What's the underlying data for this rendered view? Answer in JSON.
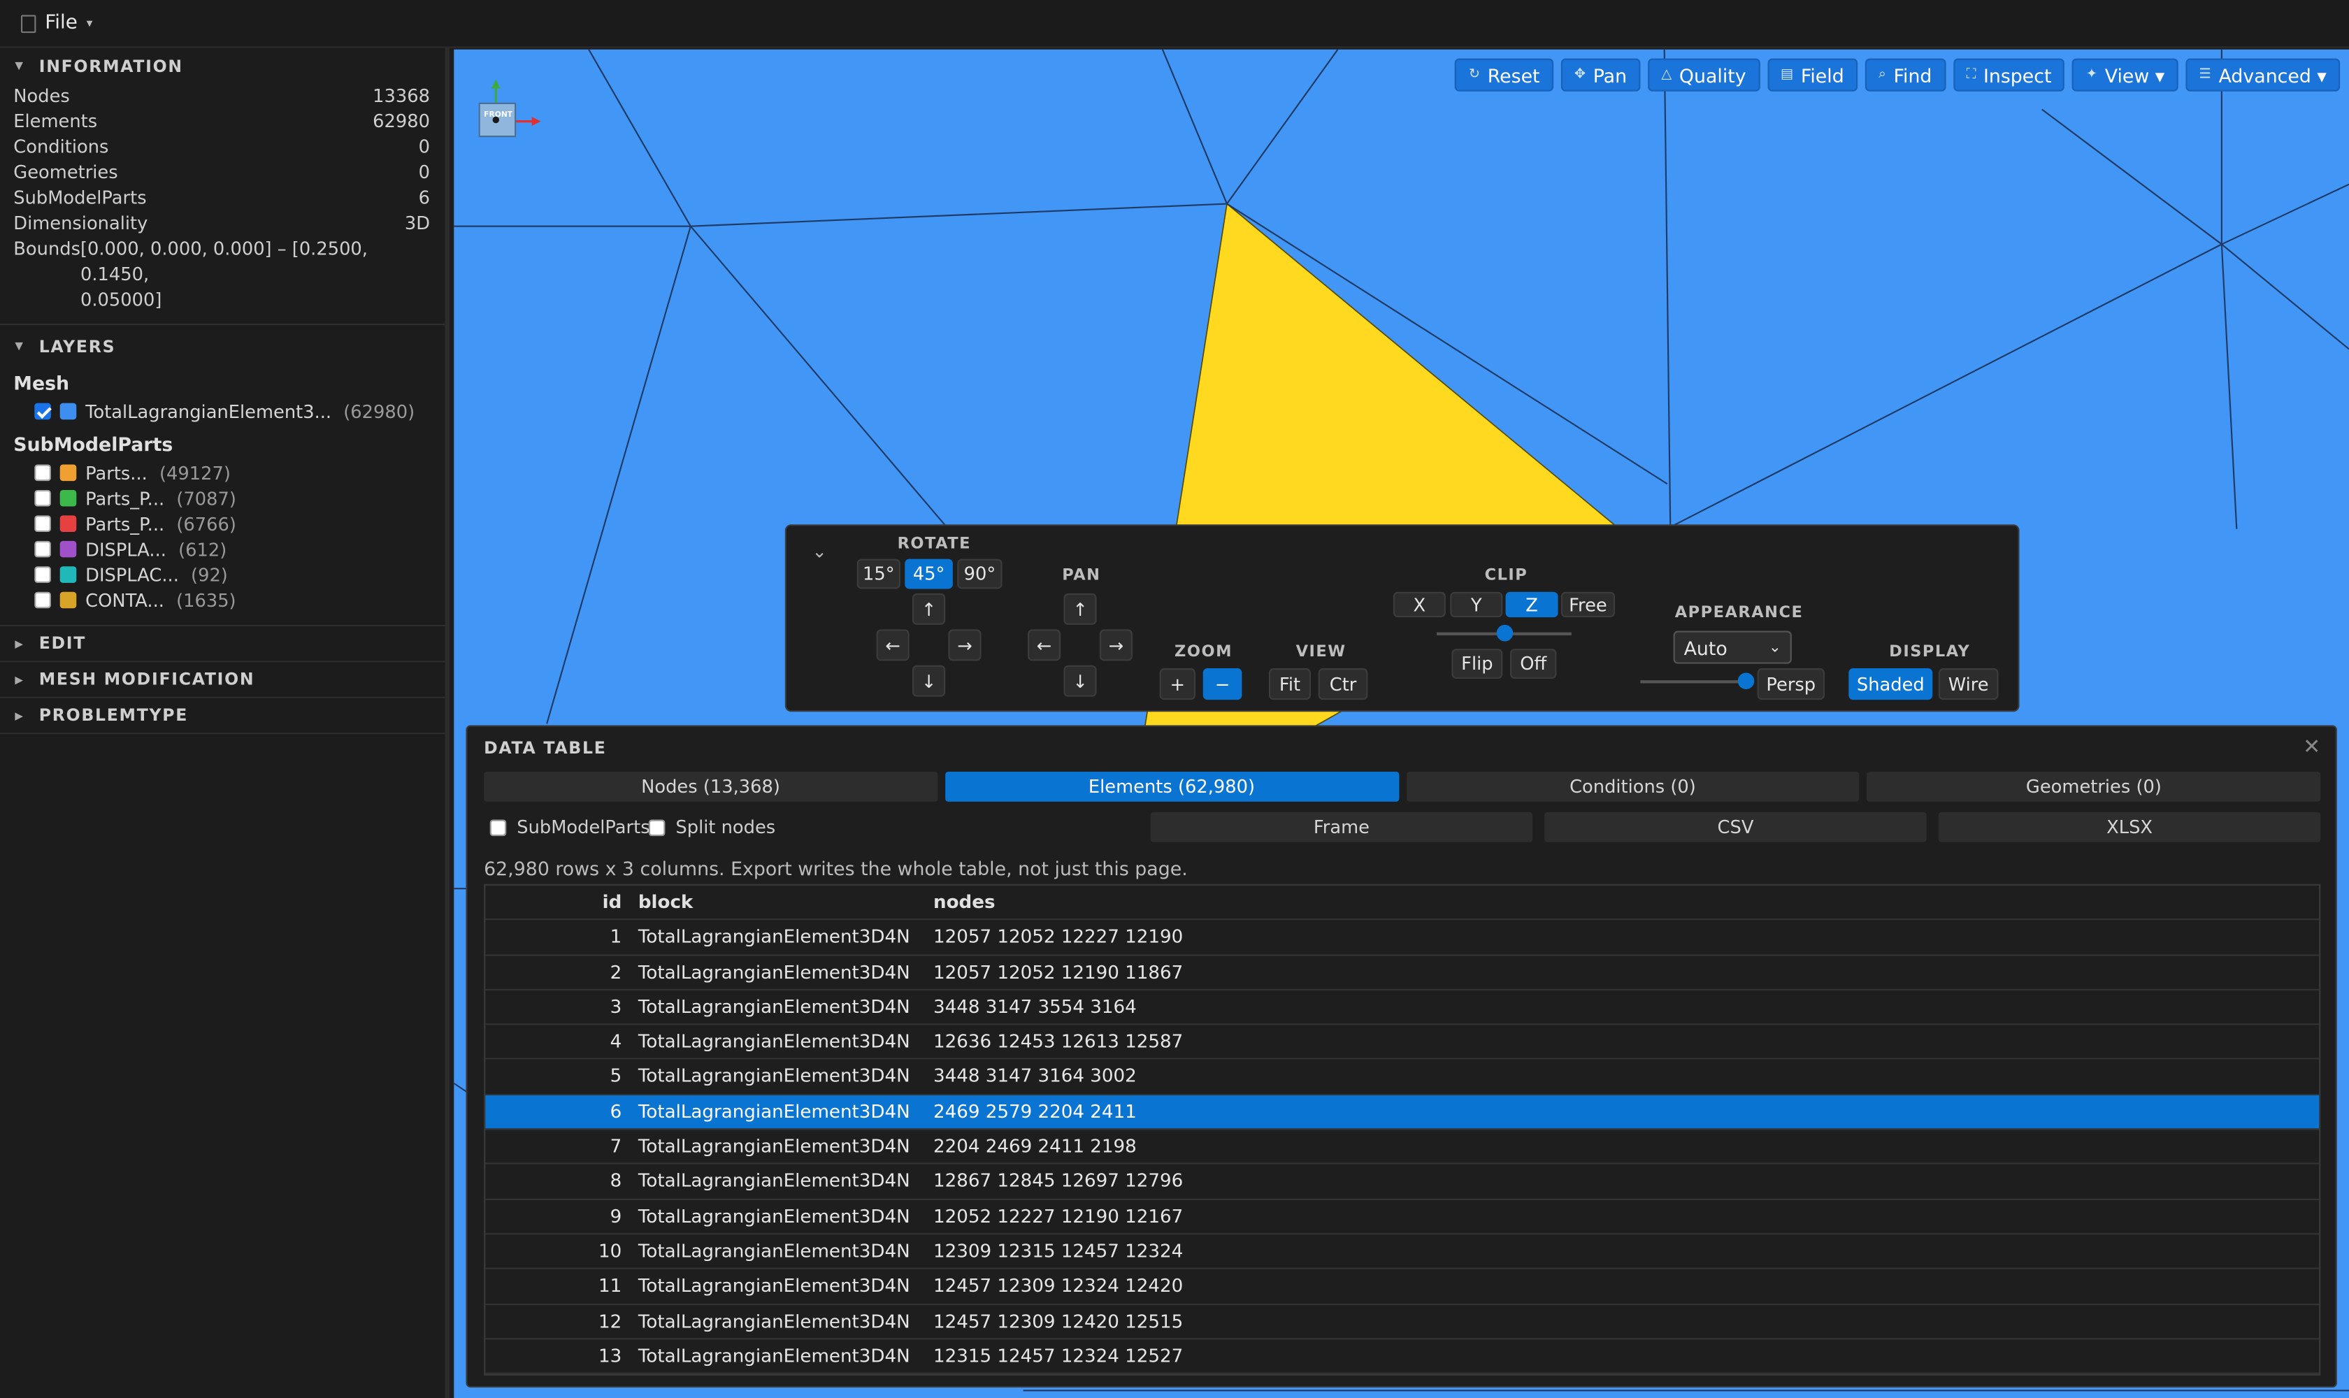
{
  "menu": {
    "file_label": "File",
    "file_caret": "▾"
  },
  "sidebar": {
    "information": {
      "title": "INFORMATION",
      "rows": [
        {
          "label": "Nodes",
          "value": "13368"
        },
        {
          "label": "Elements",
          "value": "62980"
        },
        {
          "label": "Conditions",
          "value": "0"
        },
        {
          "label": "Geometries",
          "value": "0"
        },
        {
          "label": "SubModelParts",
          "value": "6"
        },
        {
          "label": "Dimensionality",
          "value": "3D"
        }
      ],
      "bounds_label": "Bounds",
      "bounds_line1": "[0.000, 0.000, 0.000] – [0.2500, 0.1450,",
      "bounds_line2": "0.05000]"
    },
    "layers": {
      "title": "LAYERS",
      "mesh_title": "Mesh",
      "mesh_items": [
        {
          "name": "TotalLagrangianElement3...",
          "count": "(62980)",
          "checked": true,
          "color": "#3d8ef0"
        }
      ],
      "smp_title": "SubModelParts",
      "smp_items": [
        {
          "name": "Parts...",
          "count": "(49127)",
          "checked": false,
          "color": "#f0a030"
        },
        {
          "name": "Parts_P...",
          "count": "(7087)",
          "checked": false,
          "color": "#3cb94a"
        },
        {
          "name": "Parts_P...",
          "count": "(6766)",
          "checked": false,
          "color": "#e64040"
        },
        {
          "name": "DISPLA...",
          "count": "(612)",
          "checked": false,
          "color": "#a050c8"
        },
        {
          "name": "DISPLAC...",
          "count": "(92)",
          "checked": false,
          "color": "#20b8b8"
        },
        {
          "name": "CONTA...",
          "count": "(1635)",
          "checked": false,
          "color": "#d8a428"
        }
      ]
    },
    "collapsed_sections": [
      "EDIT",
      "MESH MODIFICATION",
      "PROBLEMTYPE"
    ]
  },
  "viewport": {
    "background": "#4296f5",
    "highlight_color": "#ffd91f",
    "gizmo_label": "FRONT",
    "toolbar": [
      {
        "label": "Reset",
        "icon": "reset-icon",
        "glyph": "↻"
      },
      {
        "label": "Pan",
        "icon": "pan-icon",
        "glyph": "✥"
      },
      {
        "label": "Quality",
        "icon": "quality-icon",
        "glyph": "△"
      },
      {
        "label": "Field",
        "icon": "field-icon",
        "glyph": "▤"
      },
      {
        "label": "Find",
        "icon": "find-icon",
        "glyph": "⌕"
      },
      {
        "label": "Inspect",
        "icon": "inspect-icon",
        "glyph": "⛶"
      },
      {
        "label": "View ▾",
        "icon": "view-icon",
        "glyph": "✦"
      },
      {
        "label": "Advanced ▾",
        "icon": "advanced-icon",
        "glyph": "☰"
      }
    ]
  },
  "controls": {
    "collapse_glyph": "⌄",
    "rotate": {
      "title": "ROTATE",
      "steps": [
        "15°",
        "45°",
        "90°"
      ],
      "active_step": "45°"
    },
    "arrows": {
      "up": "↑",
      "down": "↓",
      "left": "←",
      "right": "→"
    },
    "pan": {
      "title": "PAN"
    },
    "zoom": {
      "title": "ZOOM",
      "in": "+",
      "out": "−"
    },
    "view": {
      "title": "VIEW",
      "fit": "Fit",
      "center": "Ctr"
    },
    "clip": {
      "title": "CLIP",
      "axes": [
        "X",
        "Y",
        "Z",
        "Free"
      ],
      "active_axis": "Z",
      "slider_fraction": 0.5,
      "flip": "Flip",
      "off": "Off"
    },
    "appearance": {
      "title": "APPEARANCE",
      "select_value": "Auto",
      "slider_fraction": 1.0,
      "persp": "Persp"
    },
    "display": {
      "title": "DISPLAY",
      "shaded": "Shaded",
      "wire": "Wire",
      "active": "Shaded"
    }
  },
  "data_table": {
    "title": "DATA TABLE",
    "close_glyph": "✕",
    "tabs": [
      "Nodes (13,368)",
      "Elements (62,980)",
      "Conditions (0)",
      "Geometries (0)"
    ],
    "active_tab": "Elements (62,980)",
    "options": {
      "submodelparts": "SubModelParts",
      "split_nodes": "Split nodes"
    },
    "exports": [
      "Frame",
      "CSV",
      "XLSX"
    ],
    "summary": "62,980 rows x 3 columns. Export writes the whole table, not just this page.",
    "columns": [
      "id",
      "block",
      "nodes"
    ],
    "selected_id": "6",
    "rows": [
      {
        "id": "1",
        "block": "TotalLagrangianElement3D4N",
        "nodes": "12057 12052 12227 12190"
      },
      {
        "id": "2",
        "block": "TotalLagrangianElement3D4N",
        "nodes": "12057 12052 12190 11867"
      },
      {
        "id": "3",
        "block": "TotalLagrangianElement3D4N",
        "nodes": "3448 3147 3554 3164"
      },
      {
        "id": "4",
        "block": "TotalLagrangianElement3D4N",
        "nodes": "12636 12453 12613 12587"
      },
      {
        "id": "5",
        "block": "TotalLagrangianElement3D4N",
        "nodes": "3448 3147 3164 3002"
      },
      {
        "id": "6",
        "block": "TotalLagrangianElement3D4N",
        "nodes": "2469 2579 2204 2411"
      },
      {
        "id": "7",
        "block": "TotalLagrangianElement3D4N",
        "nodes": "2204 2469 2411 2198"
      },
      {
        "id": "8",
        "block": "TotalLagrangianElement3D4N",
        "nodes": "12867 12845 12697 12796"
      },
      {
        "id": "9",
        "block": "TotalLagrangianElement3D4N",
        "nodes": "12052 12227 12190 12167"
      },
      {
        "id": "10",
        "block": "TotalLagrangianElement3D4N",
        "nodes": "12309 12315 12457 12324"
      },
      {
        "id": "11",
        "block": "TotalLagrangianElement3D4N",
        "nodes": "12457 12309 12324 12420"
      },
      {
        "id": "12",
        "block": "TotalLagrangianElement3D4N",
        "nodes": "12457 12309 12420 12515"
      },
      {
        "id": "13",
        "block": "TotalLagrangianElement3D4N",
        "nodes": "12315 12457 12324 12527"
      }
    ]
  }
}
